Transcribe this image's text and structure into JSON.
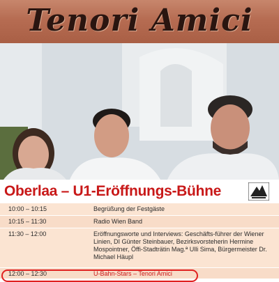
{
  "banner": {
    "title": "Tenori Amici"
  },
  "photo": {
    "description_icon": "group-photo"
  },
  "event": {
    "title": "Oberlaa – U1-Eröffnungs-Bühne",
    "logo_icon": "wiener-linien-logo"
  },
  "schedule": [
    {
      "time": "10:00 – 10:15",
      "text": "Begrüßung der Festgäste"
    },
    {
      "time": "10:15 – 11:30",
      "text": "Radio Wien Band"
    },
    {
      "time": "11:30 – 12:00",
      "text": "Eröffnungsworte und Interviews: Geschäfts-führer der Wiener Linien, DI Günter Steinbauer, Bezirksvorsteherin Hermine Mospointner, Öffi-Stadträtin Mag.ª Ulli Sima, Bürgermeister Dr. Michael Häupl"
    },
    {
      "time": "12:00 – 12:30",
      "text": "U-Bahn-Stars – Tenori Amici"
    }
  ],
  "colors": {
    "title_red": "#c81818",
    "banner_brown": "#b66c52",
    "row_peach": "#fbe4d2"
  }
}
